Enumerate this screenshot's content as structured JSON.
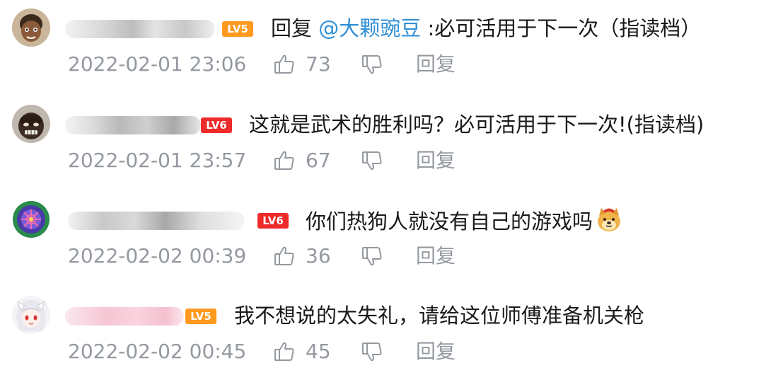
{
  "comments": [
    {
      "level_badge": "LV5",
      "content_prefix": "回复 ",
      "mention": "@大颗豌豆",
      "content_suffix": " :必可活用于下一次（指读档）",
      "time": "2022-02-01 23:06",
      "likes": "73",
      "reply_label": "回复"
    },
    {
      "level_badge": "LV6",
      "content": "这就是武术的胜利吗？必可活用于下一次!(指读档)",
      "time": "2022-02-01 23:57",
      "likes": "67",
      "reply_label": "回复"
    },
    {
      "level_badge": "LV6",
      "content": "你们热狗人就没有自己的游戏吗",
      "emoji": "doge-emoji",
      "time": "2022-02-02 00:39",
      "likes": "36",
      "reply_label": "回复"
    },
    {
      "level_badge": "LV5",
      "content": "我不想说的太失礼，请给这位师傅准备机关枪",
      "time": "2022-02-02 00:45",
      "likes": "45",
      "reply_label": "回复"
    }
  ],
  "colors": {
    "lv5": "#ff9a1f",
    "lv6": "#ee2a2a",
    "mention": "#2e8fd6",
    "meta": "#9499a0"
  }
}
